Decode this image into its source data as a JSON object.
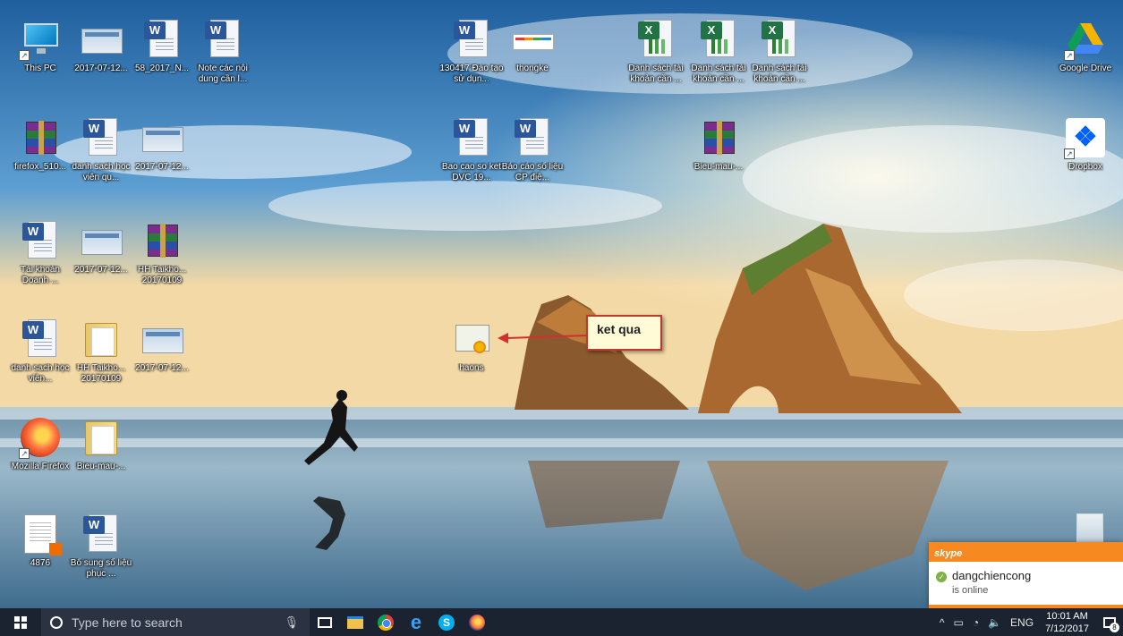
{
  "desktop": {
    "icons": [
      {
        "label": "This PC"
      },
      {
        "label": "2017-07-12..."
      },
      {
        "label": "58_2017_N..."
      },
      {
        "label": "Note các nội dung cần l..."
      },
      {
        "label": "130417 Đào tạo sử dụn..."
      },
      {
        "label": "thongke"
      },
      {
        "label": "Danh sách tài khoản cần ..."
      },
      {
        "label": "Danh sách tài khoản cần ..."
      },
      {
        "label": "Danh sách tài khoản cần ..."
      },
      {
        "label": "Google Drive"
      },
      {
        "label": "firefox_510..."
      },
      {
        "label": "danh sach học viên qu..."
      },
      {
        "label": "2017-07-12..."
      },
      {
        "label": "Bao cao so ket DVC 19..."
      },
      {
        "label": "Báo cáo số liệu CP điệ..."
      },
      {
        "label": "Bieu-mau-..."
      },
      {
        "label": "Dropbox"
      },
      {
        "label": "Tài khoản Doanh ..."
      },
      {
        "label": "2017-07-12..."
      },
      {
        "label": "HH Taikho... 20170109"
      },
      {
        "label": "danh sach học viên..."
      },
      {
        "label": "HH Taikho... 20170109"
      },
      {
        "label": "2017-07-12..."
      },
      {
        "label": "haons"
      },
      {
        "label": "Mozilla Firefox"
      },
      {
        "label": "Bieu-mau-..."
      },
      {
        "label": "4876"
      },
      {
        "label": "Bổ sung số liệu phục ..."
      }
    ]
  },
  "callout": {
    "text": "ket qua"
  },
  "skype_toast": {
    "app": "skype",
    "user": "dangchiencong",
    "status": "is online",
    "accent": "#f6891f"
  },
  "taskbar": {
    "search_placeholder": "Type here to search",
    "language": "ENG",
    "time": "10:01 AM",
    "date": "7/12/2017",
    "notification_count": "8",
    "pinned": [
      "task-view-icon",
      "file-explorer-icon",
      "chrome-icon",
      "edge-icon",
      "skype-icon",
      "firefox-icon"
    ]
  }
}
